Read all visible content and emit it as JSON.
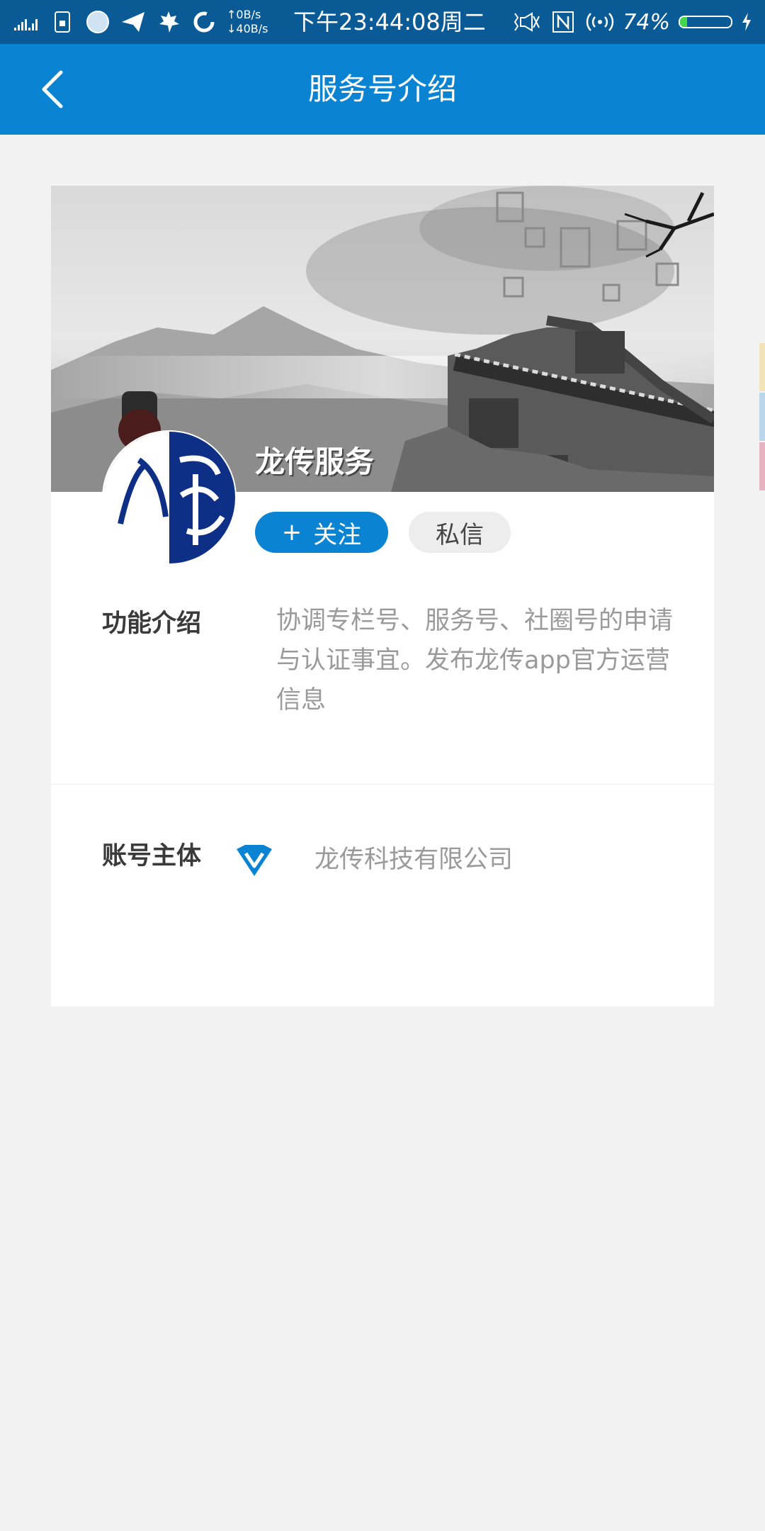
{
  "status_bar": {
    "net_up": "↑0B/s",
    "net_down": "↓40B/s",
    "time": "下午23:44:08周二",
    "battery_pct": "74%"
  },
  "header": {
    "title": "服务号介绍"
  },
  "profile": {
    "name": "龙传服务",
    "follow_icon": "+",
    "follow_label": "关注",
    "message_label": "私信"
  },
  "sections": {
    "intro_label": "功能介绍",
    "intro_text": "协调专栏号、服务号、社圈号的申请与认证事宜。发布龙传app官方运营信息",
    "owner_label": "账号主体",
    "owner_name": "龙传科技有限公司"
  },
  "colors": {
    "status_bar": "#0a5a95",
    "header": "#0a83d2",
    "accent": "#0a83d2",
    "page_bg": "#f2f2f2"
  }
}
